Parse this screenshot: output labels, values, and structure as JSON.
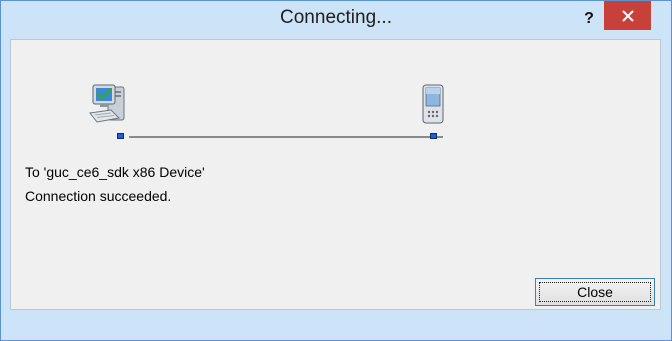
{
  "window": {
    "title": "Connecting...",
    "help_label": "?",
    "close_glyph": "×"
  },
  "status": {
    "target_line": "To 'guc_ce6_sdk x86 Device'",
    "result_line": "Connection succeeded."
  },
  "buttons": {
    "close_label": "Close"
  },
  "icons": {
    "left": "desktop-computer-check-icon",
    "right": "mobile-device-icon"
  },
  "colors": {
    "titlebar": "#cde3f7",
    "close_button": "#c7403a",
    "content_background": "#f0f0f0",
    "port": "#1e5fd6"
  }
}
